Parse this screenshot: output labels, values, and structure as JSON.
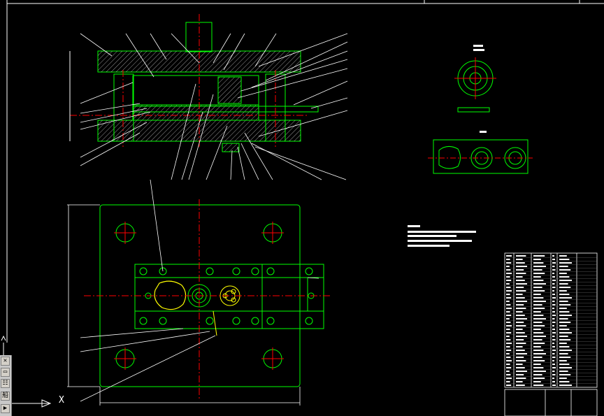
{
  "viewport": {
    "background": "#000000",
    "line_colors": {
      "outline": "#00ff00",
      "center": "#ff0000",
      "leader": "#ffffff",
      "part": "#ffff00"
    }
  },
  "ucs": {
    "x_label": "X"
  },
  "toolbox": {
    "items": [
      {
        "icon": "close-icon",
        "label": "✕"
      },
      {
        "icon": "window-icon",
        "label": "▭"
      },
      {
        "icon": "options-icon",
        "label": "☷"
      },
      {
        "icon": "text-icon",
        "label": "船"
      },
      {
        "icon": "expand-icon",
        "label": "▶"
      }
    ]
  }
}
